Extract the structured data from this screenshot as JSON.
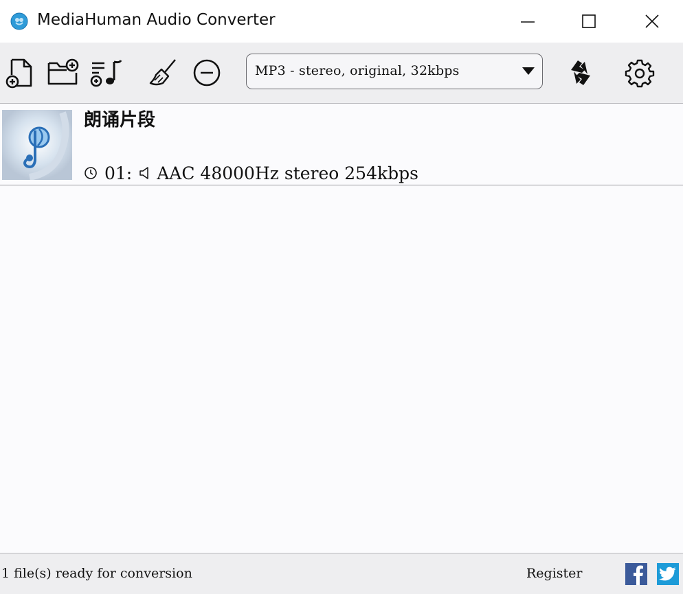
{
  "window": {
    "title": "MediaHuman Audio Converter",
    "accent_color": "#2f9bd8"
  },
  "toolbar": {
    "buttons": [
      {
        "icon": "add-file-icon"
      },
      {
        "icon": "add-folder-icon"
      },
      {
        "icon": "add-itunes-playlist-icon"
      },
      {
        "icon": "broom-icon"
      },
      {
        "icon": "minus-circle-icon"
      },
      {
        "icon": "convert-icon"
      },
      {
        "icon": "gear-icon"
      }
    ],
    "format_select": {
      "value": "MP3 - stereo, original, 32kbps"
    }
  },
  "file_list": {
    "items": [
      {
        "name": "朗诵片段",
        "track": "01:",
        "codec_info": "AAC 48000Hz stereo 254kbps"
      }
    ]
  },
  "statusbar": {
    "status": "1 file(s) ready for conversion",
    "register": "Register",
    "facebook_color": "#3b5a9a",
    "twitter_color": "#1d9bd8"
  }
}
